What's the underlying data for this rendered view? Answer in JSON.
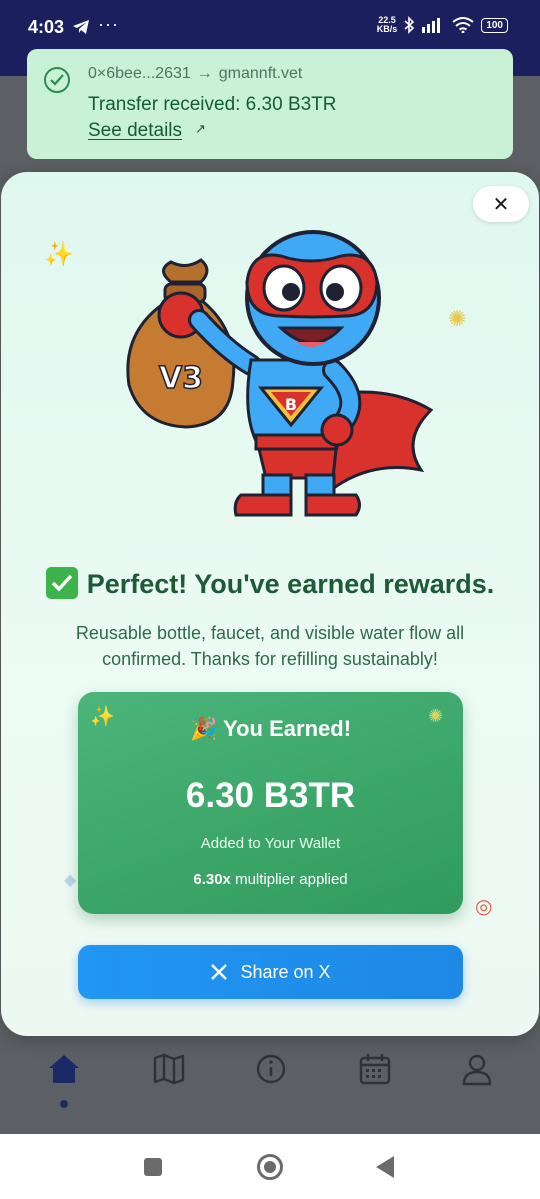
{
  "status_bar": {
    "time": "4:03",
    "more": "···",
    "net_speed": "22.5",
    "net_unit": "KB/s",
    "battery": "100"
  },
  "toast": {
    "from": "0×6bee...2631",
    "arrow": "→",
    "to": "gmannft.vet",
    "title": "Transfer received: 6.30 B3TR",
    "link": "See details",
    "link_icon": "↗"
  },
  "modal": {
    "close_label": "✕",
    "headline": "Perfect! You've earned rewards.",
    "message": "Reusable bottle, faucet, and visible water flow all confirmed. Thanks for refilling sustainably!",
    "card": {
      "title": "You Earned!",
      "title_emoji": "🎉",
      "amount": "6.30 B3TR",
      "wallet_note": "Added to Your Wallet",
      "multiplier_value": "6.30x",
      "multiplier_text": "multiplier applied"
    },
    "share_label": "Share on X",
    "mascot_bag_label": "V3",
    "mascot_chest_label": "B"
  },
  "bottom_nav": {
    "items": [
      "home-icon",
      "map-icon",
      "info-icon",
      "calendar-icon",
      "profile-icon"
    ],
    "active": "home-icon"
  },
  "colors": {
    "toast_bg": "#c9f1d6",
    "card_green": "#3aa86a",
    "share_blue": "#1e88e5",
    "headline_green": "#1d5a38"
  }
}
